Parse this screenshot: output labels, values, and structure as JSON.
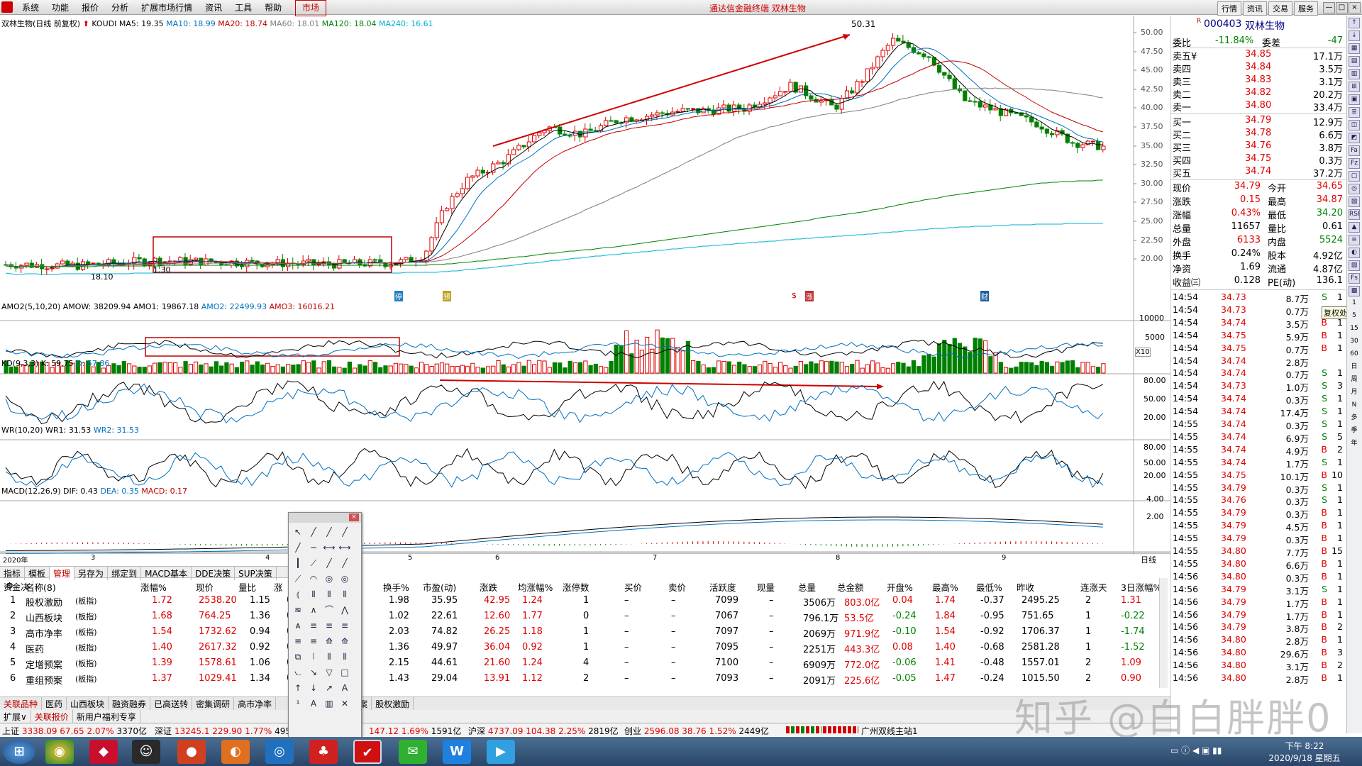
{
  "menu": {
    "items": [
      "系统",
      "功能",
      "报价",
      "分析",
      "扩展市场行情",
      "资讯",
      "工具",
      "帮助"
    ],
    "market": "市场",
    "app_title": "通达信金融终端 双林生物",
    "right_buttons": [
      "行情",
      "资讯",
      "交易",
      "服务"
    ],
    "win_buttons": [
      "—",
      "□",
      "×"
    ]
  },
  "chart": {
    "title": "双林生物(日线 前复权)",
    "ma_text": {
      "koudi": "KOUDI",
      "ma5": "MA5: 19.35",
      "ma10": "MA10: 18.99",
      "ma20": "MA20: 18.74",
      "ma60": "MA60: 18.01",
      "ma120": "MA120: 18.04",
      "ma240": "MA240: 16.61"
    },
    "high_mark": "50.31",
    "low_mark": "18.10",
    "low_mark2": "1.30",
    "ylabels": [
      "50.00",
      "47.50",
      "45.00",
      "42.50",
      "40.00",
      "37.50",
      "35.00",
      "32.50",
      "30.00",
      "27.50",
      "25.00",
      "22.50",
      "20.00"
    ],
    "ma_legend_colors": {
      "ma5": "#000000",
      "ma10": "#0070c0",
      "ma20": "#c00000",
      "ma60": "#808080",
      "ma120": "#008000",
      "ma240": "#00b0d0"
    },
    "event_tags": [
      "停",
      "预",
      "$",
      "涨",
      "财"
    ],
    "marks": [
      "60",
      "40",
      "40",
      "40"
    ]
  },
  "volume": {
    "title": "AMO2(5,10,20)",
    "amow": "AMOW: 38209.94",
    "amo1": "AMO1: 19867.18",
    "amo2": "AMO2: 22499.93",
    "amo3": "AMO3: 16016.21",
    "ylabels": [
      "10000",
      "5000",
      "X10"
    ]
  },
  "kd": {
    "title": "KD(9,3,3)",
    "k": "K: 59.75",
    "d": "D: 57.86",
    "ylabels": [
      "80.00",
      "50.00",
      "20.00"
    ]
  },
  "wr": {
    "title": "WR(10,20)",
    "wr1": "WR1: 31.53",
    "wr2": "WR2: 31.53",
    "ylabels": [
      "80.00",
      "50.00",
      "20.00"
    ]
  },
  "macd": {
    "title": "MACD(12,26,9)",
    "dif": "DIF: 0.43",
    "dea": "DEA: 0.35",
    "macd": "MACD: 0.17",
    "ylabels": [
      "4.00",
      "2.00"
    ]
  },
  "xaxis": {
    "labels": [
      "2020年",
      "3",
      "4",
      "5",
      "6",
      "7",
      "8",
      "9"
    ],
    "period": "日线"
  },
  "tabs_top": [
    "指标",
    "模板",
    "管理",
    "另存为",
    "绑定到",
    "MACD基本",
    "DDE决策",
    "SUP决策",
    "资金决"
  ],
  "table": {
    "headers": [
      "名称(8)",
      "涨幅%",
      "现价",
      "量比",
      "涨",
      "换手%",
      "市盈(动)",
      "涨跌",
      "均涨幅%",
      "涨停数",
      "买价",
      "卖价",
      "活跃度",
      "现量",
      "总量",
      "总金额",
      "开盘%",
      "最高%",
      "最低%",
      "昨收",
      "连涨天",
      "3日涨幅%"
    ],
    "rows": [
      [
        "1",
        "股权激励",
        "(板指)",
        "1.72",
        "2538.20",
        "1.15",
        "0",
        "1.98",
        "35.95",
        "42.95",
        "1.24",
        "1",
        "–",
        "–",
        "7099",
        "–",
        "3506万",
        "803.0亿",
        "0.04",
        "1.74",
        "-0.37",
        "2495.25",
        "2",
        "1.31"
      ],
      [
        "2",
        "山西板块",
        "(板指)",
        "1.68",
        "764.25",
        "1.36",
        "0",
        "1.02",
        "22.61",
        "12.60",
        "1.77",
        "0",
        "–",
        "–",
        "7067",
        "–",
        "796.1万",
        "53.5亿",
        "-0.24",
        "1.84",
        "-0.95",
        "751.65",
        "1",
        "-0.22"
      ],
      [
        "3",
        "高市净率",
        "(板指)",
        "1.54",
        "1732.62",
        "0.94",
        "0",
        "2.03",
        "74.82",
        "26.25",
        "1.18",
        "1",
        "–",
        "–",
        "7097",
        "–",
        "2069万",
        "971.9亿",
        "-0.10",
        "1.54",
        "-0.92",
        "1706.37",
        "1",
        "-1.74"
      ],
      [
        "4",
        "医药",
        "(板指)",
        "1.40",
        "2617.32",
        "0.92",
        "0",
        "1.36",
        "49.97",
        "36.04",
        "0.92",
        "1",
        "–",
        "–",
        "7095",
        "–",
        "2251万",
        "443.3亿",
        "0.08",
        "1.40",
        "-0.68",
        "2581.28",
        "1",
        "-1.52"
      ],
      [
        "5",
        "定增预案",
        "(板指)",
        "1.39",
        "1578.61",
        "1.06",
        "0",
        "2.15",
        "44.61",
        "21.60",
        "1.24",
        "4",
        "–",
        "–",
        "7100",
        "–",
        "6909万",
        "772.0亿",
        "-0.06",
        "1.41",
        "-0.48",
        "1557.01",
        "2",
        "1.09"
      ],
      [
        "6",
        "重组预案",
        "(板指)",
        "1.37",
        "1029.41",
        "1.34",
        "0",
        "1.43",
        "29.04",
        "13.91",
        "1.12",
        "2",
        "–",
        "–",
        "7093",
        "–",
        "2091万",
        "225.6亿",
        "-0.05",
        "1.47",
        "-0.24",
        "1015.50",
        "2",
        "0.90"
      ]
    ]
  },
  "bottom_tabs": [
    "关联品种",
    "医药",
    "山西板块",
    "融资融券",
    "已高送转",
    "密集调研",
    "高市净率",
    "预案",
    "股权激励"
  ],
  "bottom_tabs2": [
    "扩展∨",
    "关联报价",
    "新用户福利专享"
  ],
  "status": [
    "上证",
    "3338.09",
    "67.65",
    "2.07%",
    "3370亿",
    "深证",
    "13245.1",
    "229.90",
    "1.77%",
    "4951亿",
    "147.12",
    "1.69%",
    "1591亿",
    "沪深",
    "4737.09",
    "104.38",
    "2.25%",
    "2819亿",
    "创业",
    "2596.08",
    "38.76",
    "1.52%",
    "2449亿",
    "广州双线主站1"
  ],
  "quote": {
    "code": "000403",
    "name": "双林生物",
    "weibi_label": "委比",
    "weibi": "-11.84%",
    "weicha_label": "委差",
    "weicha": "-47",
    "sell": [
      [
        "卖五¥",
        "34.85",
        "17.1万"
      ],
      [
        "卖四",
        "34.84",
        "3.5万"
      ],
      [
        "卖三",
        "34.83",
        "3.1万"
      ],
      [
        "卖二",
        "34.82",
        "20.2万"
      ],
      [
        "卖一",
        "34.80",
        "33.4万"
      ]
    ],
    "buy": [
      [
        "买一",
        "34.79",
        "12.9万"
      ],
      [
        "买二",
        "34.78",
        "6.6万"
      ],
      [
        "买三",
        "34.76",
        "3.8万"
      ],
      [
        "买四",
        "34.75",
        "0.3万"
      ],
      [
        "买五",
        "34.74",
        "37.2万"
      ]
    ],
    "stats": [
      [
        "现价",
        "34.79",
        "今开",
        "34.65"
      ],
      [
        "涨跌",
        "0.15",
        "最高",
        "34.87"
      ],
      [
        "涨幅",
        "0.43%",
        "最低",
        "34.20"
      ],
      [
        "总量",
        "11657",
        "量比",
        "0.61"
      ],
      [
        "外盘",
        "6133",
        "内盘",
        "5524"
      ],
      [
        "换手",
        "0.24%",
        "股本",
        "4.92亿"
      ],
      [
        "净资",
        "1.69",
        "流通",
        "4.87亿"
      ],
      [
        "收益㈢",
        "0.128",
        "PE(动)",
        "136.1"
      ]
    ],
    "tooltip": "复权处理"
  },
  "ticks": [
    [
      "14:54",
      "34.73",
      "8.7万",
      "S",
      "1"
    ],
    [
      "14:54",
      "34.73",
      "0.7万",
      "S",
      "1"
    ],
    [
      "14:54",
      "34.74",
      "3.5万",
      "B",
      "1"
    ],
    [
      "14:54",
      "34.75",
      "5.9万",
      "B",
      "1"
    ],
    [
      "14:54",
      "34.75",
      "0.7万",
      "B",
      "1"
    ],
    [
      "14:54",
      "34.74",
      "2.8万",
      "",
      ""
    ],
    [
      "14:54",
      "34.74",
      "0.7万",
      "S",
      "1"
    ],
    [
      "14:54",
      "34.73",
      "1.0万",
      "S",
      "3"
    ],
    [
      "14:54",
      "34.74",
      "0.3万",
      "S",
      "1"
    ],
    [
      "14:54",
      "34.74",
      "17.4万",
      "S",
      "1"
    ],
    [
      "14:55",
      "34.74",
      "0.3万",
      "S",
      "1"
    ],
    [
      "14:55",
      "34.74",
      "6.9万",
      "S",
      "5"
    ],
    [
      "14:55",
      "34.74",
      "4.9万",
      "B",
      "2"
    ],
    [
      "14:55",
      "34.74",
      "1.7万",
      "S",
      "1"
    ],
    [
      "14:55",
      "34.75",
      "10.1万",
      "B",
      "10"
    ],
    [
      "14:55",
      "34.79",
      "0.3万",
      "S",
      "1"
    ],
    [
      "14:55",
      "34.76",
      "0.3万",
      "S",
      "1"
    ],
    [
      "14:55",
      "34.79",
      "0.3万",
      "B",
      "1"
    ],
    [
      "14:55",
      "34.79",
      "4.5万",
      "B",
      "1"
    ],
    [
      "14:55",
      "34.79",
      "0.3万",
      "B",
      "1"
    ],
    [
      "14:55",
      "34.80",
      "7.7万",
      "B",
      "15"
    ],
    [
      "14:55",
      "34.80",
      "6.6万",
      "B",
      "1"
    ],
    [
      "14:56",
      "34.80",
      "0.3万",
      "B",
      "1"
    ],
    [
      "14:56",
      "34.79",
      "3.1万",
      "S",
      "1"
    ],
    [
      "14:56",
      "34.79",
      "1.7万",
      "B",
      "1"
    ],
    [
      "14:56",
      "34.79",
      "1.7万",
      "B",
      "1"
    ],
    [
      "14:56",
      "34.79",
      "3.8万",
      "B",
      "2"
    ],
    [
      "14:56",
      "34.80",
      "2.8万",
      "B",
      "1"
    ],
    [
      "14:56",
      "34.80",
      "29.6万",
      "B",
      "3"
    ],
    [
      "14:56",
      "34.80",
      "3.1万",
      "B",
      "2"
    ],
    [
      "14:56",
      "34.80",
      "2.8万",
      "B",
      "1"
    ]
  ],
  "taskbar": {
    "time": "下午 8:22",
    "date": "2020/9/18 星期五"
  },
  "watermark": "知乎 @白白胖胖0",
  "colors": {
    "up": "#e00000",
    "down": "#008000",
    "frame": "#c00000"
  }
}
